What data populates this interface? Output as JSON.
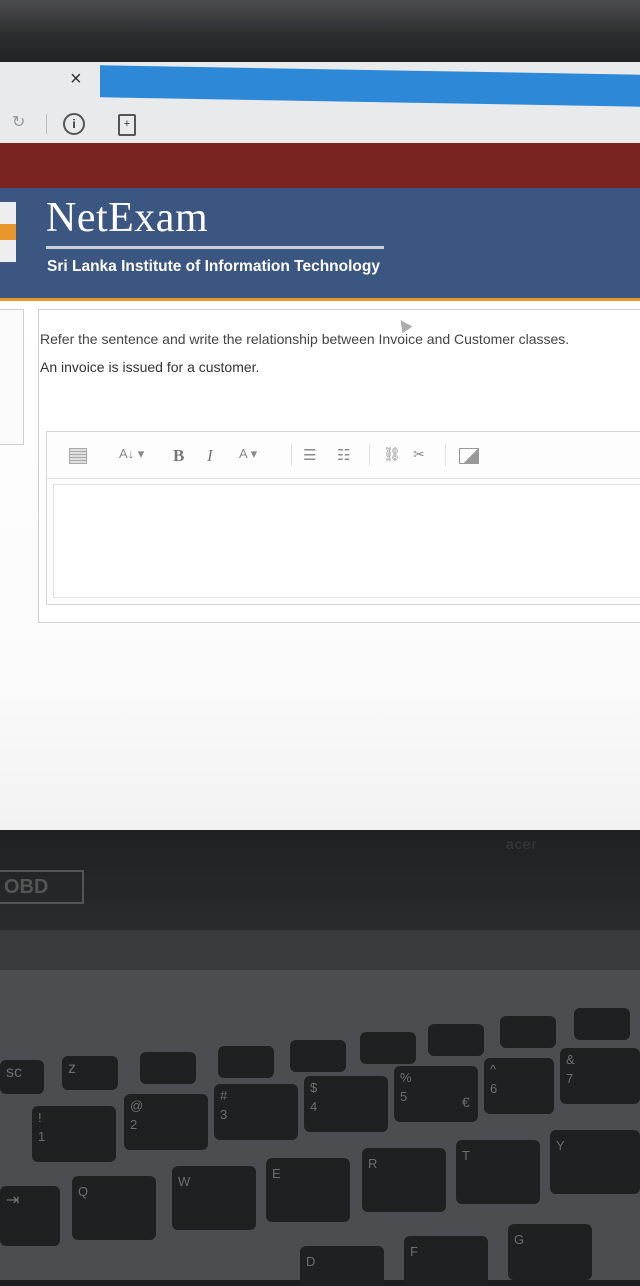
{
  "browser": {
    "close_glyph": "×",
    "reload_glyph": "↻",
    "info_glyph": "i",
    "page_glyph": "+"
  },
  "header": {
    "brand": "NetExam",
    "subtitle": "Sri Lanka Institute of Information Technology"
  },
  "question": {
    "line1": "Refer the sentence and write the relationship between Invoice and Customer classes.",
    "line2": "An invoice is issued for a customer."
  },
  "editor": {
    "toolbar": {
      "paragraph": "A↓ ▾",
      "bold": "B",
      "italic": "I",
      "font_color": "A ▾",
      "unordered_list": "☰",
      "ordered_list": "☷",
      "link": "⛓",
      "unlink": "✂"
    },
    "value": ""
  },
  "laptop": {
    "sticker": "OBD",
    "brand": "acer",
    "keys": {
      "esc": "sc",
      "z": "z",
      "n1_top": "!",
      "n1_bot": "1",
      "n2_top": "@",
      "n2_bot": "2",
      "n3_top": "#",
      "n3_bot": "3",
      "n4_top": "$",
      "n4_bot": "4",
      "n5_top": "%",
      "n5_bot": "5",
      "euro": "€",
      "n6_top": "^",
      "n6_bot": "6",
      "n7_top": "&",
      "n7_bot": "7",
      "q": "Q",
      "w": "W",
      "e": "E",
      "r": "R",
      "t": "T",
      "y": "Y",
      "d": "D",
      "f": "F",
      "g": "G",
      "tab": "⇥"
    }
  },
  "colors": {
    "header_bg": "#3b5680",
    "accent_orange": "#e8972c",
    "maroon": "#7a2421",
    "tab_blue": "#2e88d8"
  }
}
